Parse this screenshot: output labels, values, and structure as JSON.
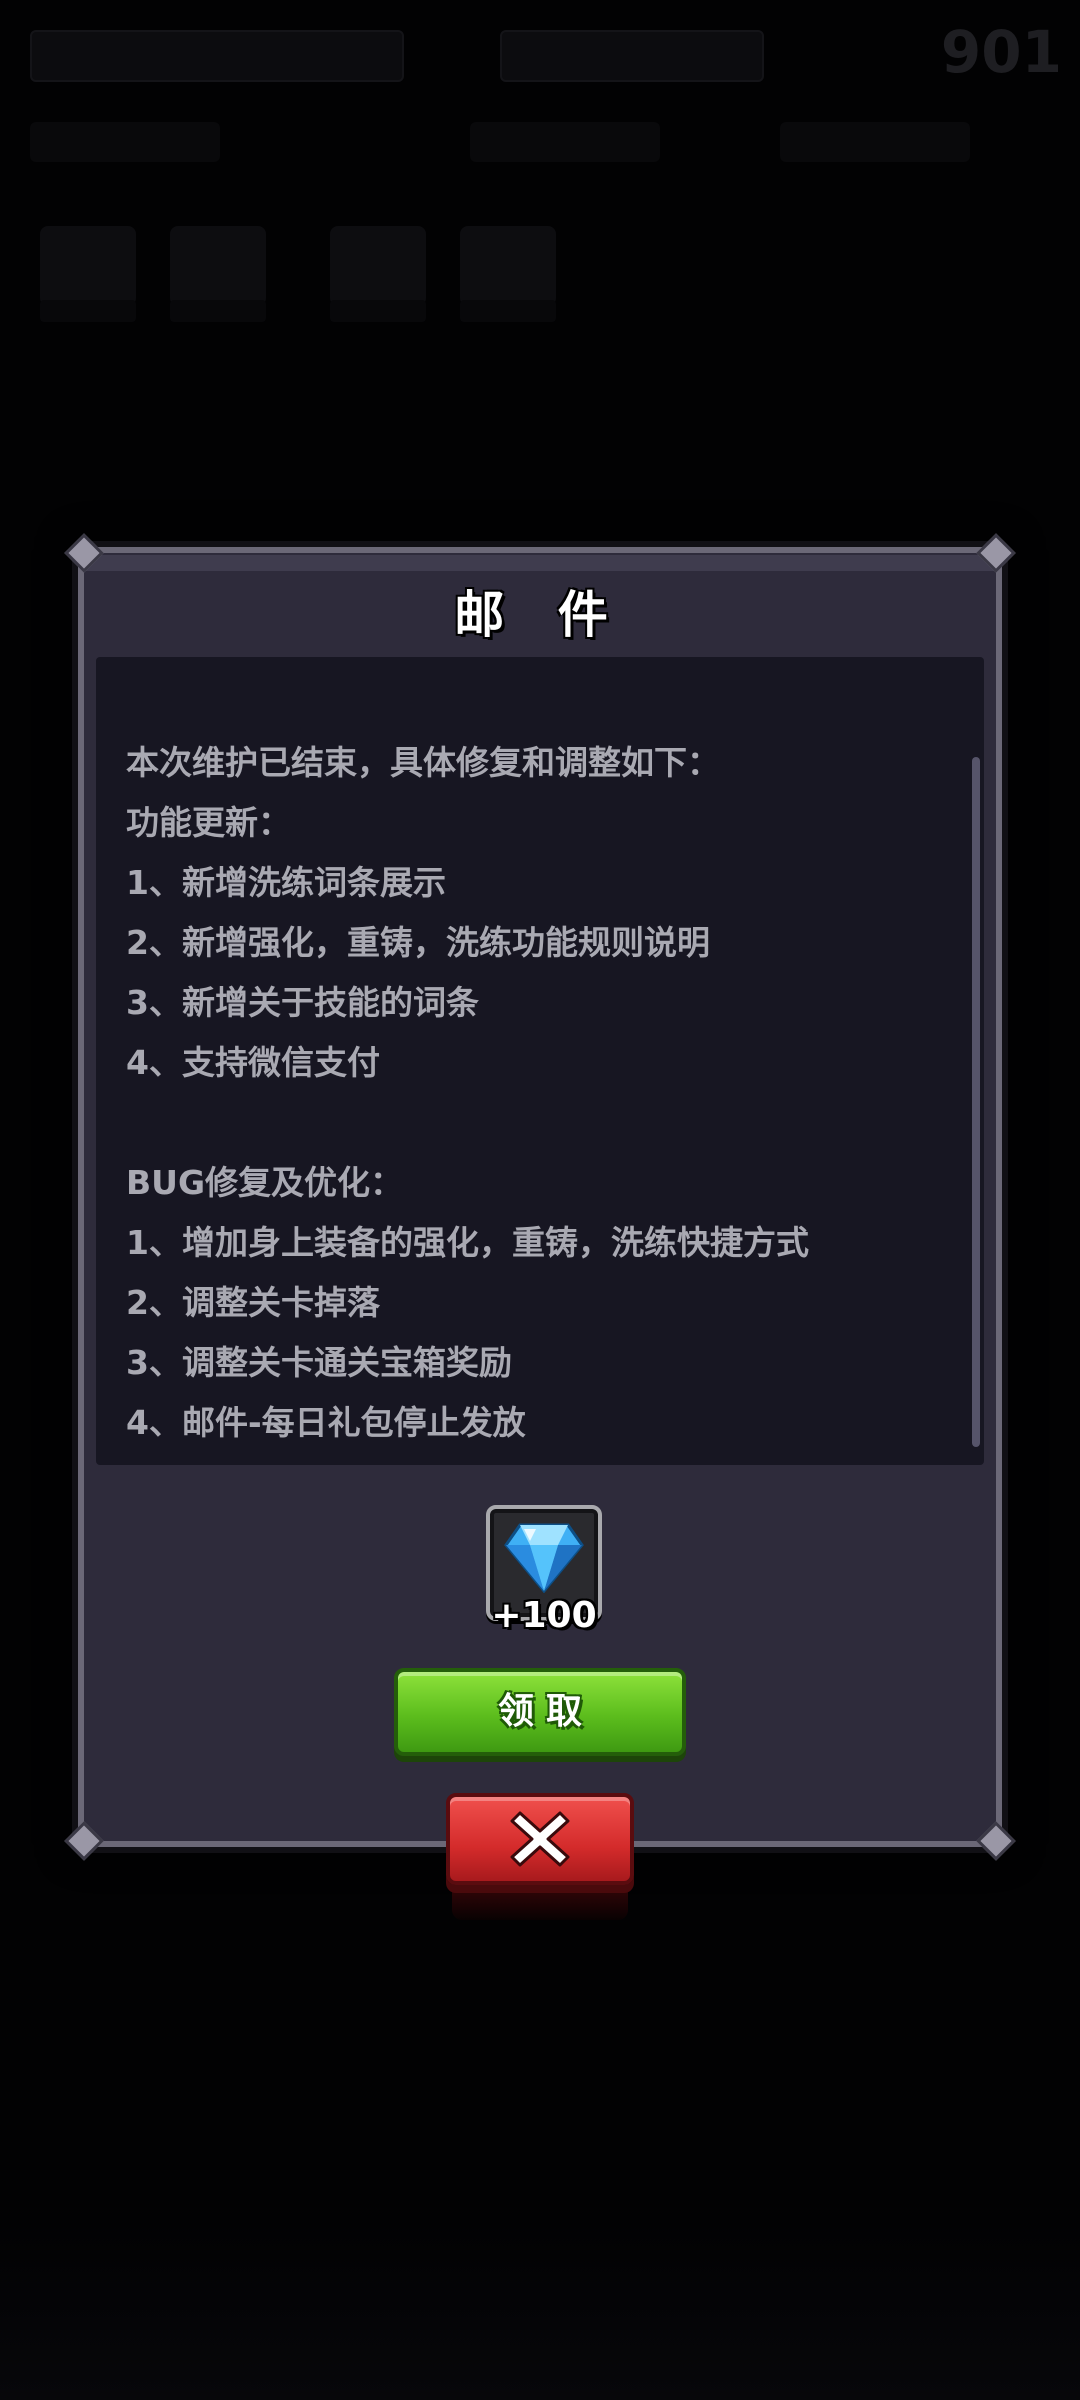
{
  "background": {
    "top_right_value": "901"
  },
  "dialog": {
    "title": "邮 件",
    "content": "本次维护已结束，具体修复和调整如下：\n功能更新：\n1、新增洗练词条展示\n2、新增强化，重铸，洗练功能规则说明\n3、新增关于技能的词条\n4、支持微信支付\n\nBUG修复及优化：\n1、增加身上装备的强化，重铸，洗练快捷方式\n2、调整关卡掉落\n3、调整关卡通关宝箱奖励\n4、邮件-每日礼包停止发放",
    "reward": {
      "icon": "diamond-icon",
      "count": "+100"
    },
    "claim_label": "领取",
    "close_icon": "close-x-icon"
  },
  "colors": {
    "dialog_bg": "#2e2b3b",
    "content_bg": "#171622",
    "text": "#a9a9b2",
    "claim_green": "#5cbd1d",
    "close_red": "#d42b2b"
  }
}
